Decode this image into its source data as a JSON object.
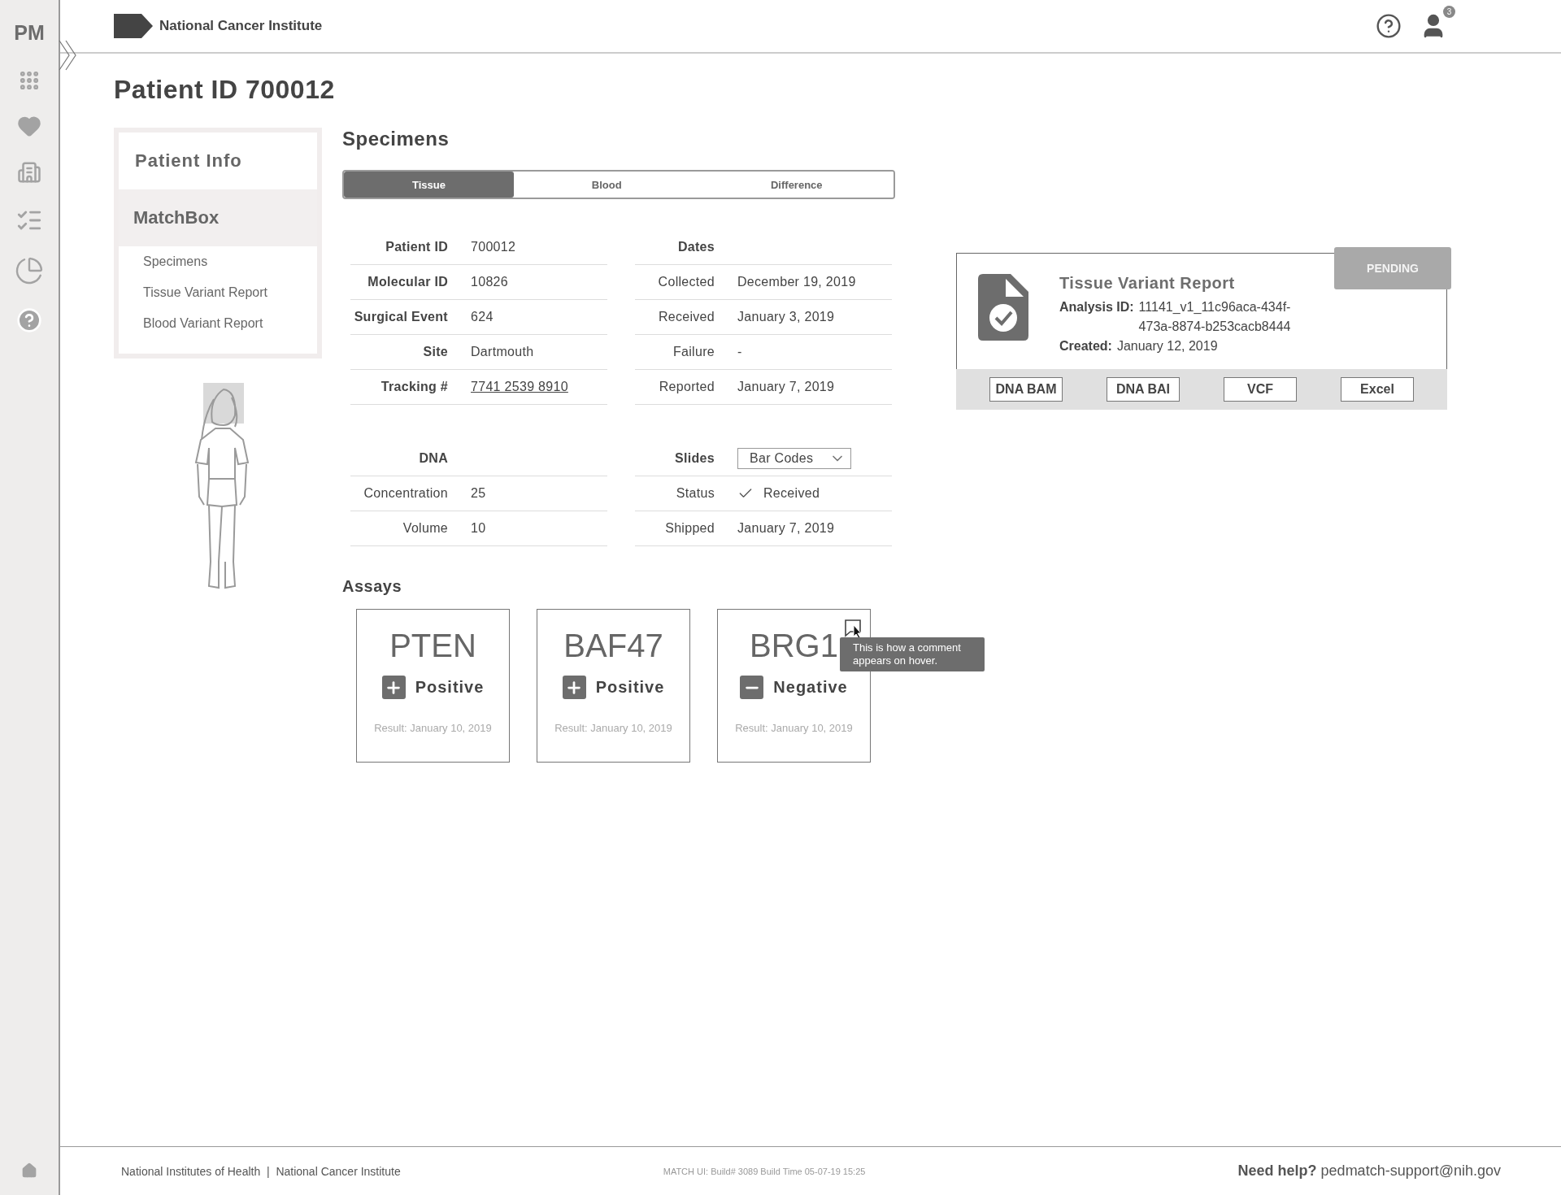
{
  "sidebar": {
    "logo": "PM"
  },
  "header": {
    "org": "National Cancer Institute",
    "notifications": "3"
  },
  "title": "Patient ID 700012",
  "nav": {
    "sections": [
      {
        "label": "Patient Info",
        "selected": false
      },
      {
        "label": "MatchBox",
        "selected": true,
        "children": [
          {
            "label": "Specimens"
          },
          {
            "label": "Tissue Variant Report"
          },
          {
            "label": "Blood Variant Report"
          }
        ]
      }
    ]
  },
  "specimens": {
    "title": "Specimens",
    "tabs": [
      {
        "label": "Tissue",
        "selected": true
      },
      {
        "label": "Blood",
        "selected": false
      },
      {
        "label": "Difference",
        "selected": false
      }
    ],
    "identifiers": [
      {
        "label": "Patient ID",
        "value": "700012",
        "kind": "text"
      },
      {
        "label": "Molecular ID",
        "value": "10826",
        "kind": "text"
      },
      {
        "label": "Surgical Event",
        "value": "624",
        "kind": "text"
      },
      {
        "label": "Site",
        "value": "Dartmouth",
        "kind": "text"
      },
      {
        "label": "Tracking #",
        "value": "7741 2539 8910",
        "kind": "link"
      }
    ],
    "dates": {
      "heading": "Dates",
      "rows": [
        {
          "label": "Collected",
          "value": "December 19, 2019"
        },
        {
          "label": "Received",
          "value": "January 3, 2019"
        },
        {
          "label": "Failure",
          "value": "-"
        },
        {
          "label": "Reported",
          "value": "January 7, 2019"
        }
      ]
    },
    "dna": {
      "heading": "DNA",
      "rows": [
        {
          "label": "Concentration",
          "value": "25"
        },
        {
          "label": "Volume",
          "value": "10"
        }
      ]
    },
    "slides": {
      "heading": "Slides",
      "select": {
        "value": "Bar Codes"
      },
      "rows": [
        {
          "label": "Status",
          "value": "Received",
          "checked": true
        },
        {
          "label": "Shipped",
          "value": "January 7, 2019",
          "checked": false
        }
      ]
    }
  },
  "report": {
    "title": "Tissue Variant Report",
    "status": "PENDING",
    "fields": [
      {
        "label": "Analysis ID:",
        "value": "11141_v1_11c96aca-434f-473a-8874-b253cacb8444"
      },
      {
        "label": "Created:",
        "value": "January 12, 2019"
      }
    ],
    "buttons": [
      "DNA BAM",
      "DNA BAI",
      "VCF",
      "Excel"
    ]
  },
  "assays": {
    "title": "Assays",
    "items": [
      {
        "gene": "PTEN",
        "kind": "positive",
        "result": "Positive",
        "date": "Result: January 10, 2019"
      },
      {
        "gene": "BAF47",
        "kind": "positive",
        "result": "Positive",
        "date": "Result: January 10, 2019"
      },
      {
        "gene": "BRG1",
        "kind": "negative",
        "result": "Negative",
        "date": "Result: January 10, 2019",
        "comment": "This is how a comment appears on hover."
      }
    ]
  },
  "footer": {
    "left": "National Institutes of Health  |  National Cancer Institute",
    "build": "MATCH UI: Build# 3089 Build Time 05-07-19 15:25",
    "help": "**Need help?** pedmatch-support@nih.gov"
  }
}
